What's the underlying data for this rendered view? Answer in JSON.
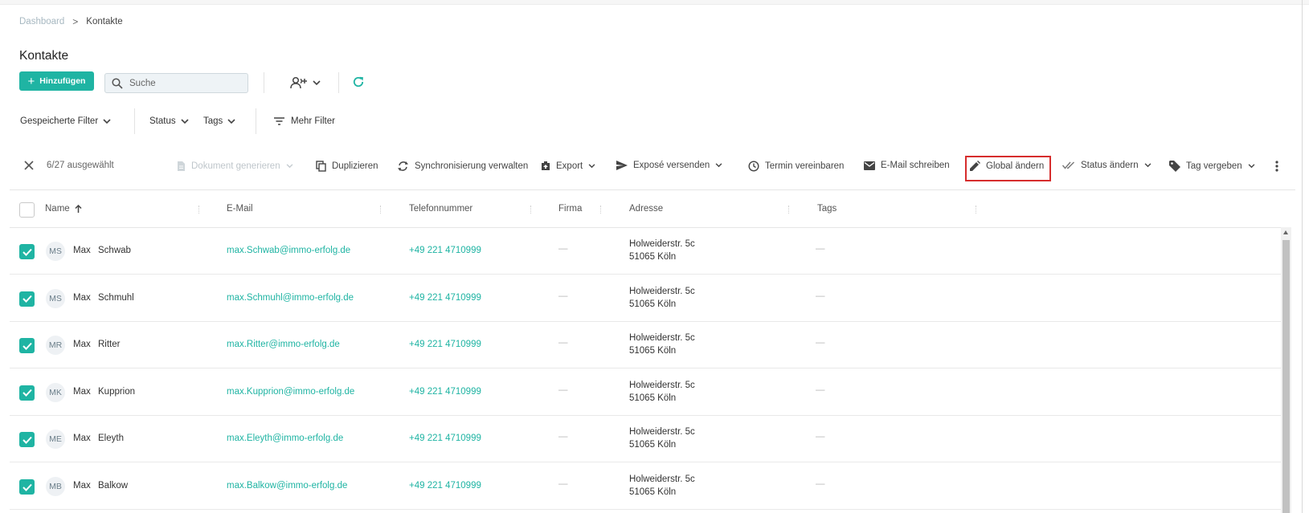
{
  "breadcrumb": {
    "items": [
      "Dashboard",
      "Kontakte"
    ],
    "separator": ">"
  },
  "page": {
    "title": "Kontakte"
  },
  "toolbar": {
    "add_label": "Hinzufügen",
    "search_placeholder": "Suche",
    "add_person_icon": "person-add-icon",
    "refresh_icon": "refresh-icon"
  },
  "filters": {
    "saved_filter": "Gespeicherte Filter",
    "status": "Status",
    "tags": "Tags",
    "more_filter": "Mehr Filter"
  },
  "actions": {
    "selected": "6/27 ausgewählt",
    "generate_document": "Dokument generieren",
    "duplicate": "Duplizieren",
    "sync": "Synchronisierung verwalten",
    "export": "Export",
    "send_expose": "Exposé versenden",
    "appointment": "Termin vereinbaren",
    "email": "E-Mail schreiben",
    "global_change": "Global ändern",
    "status_change": "Status ändern",
    "assign_tag": "Tag vergeben"
  },
  "table": {
    "columns": [
      "Name",
      "E-Mail",
      "Telefonnummer",
      "Firma",
      "Adresse",
      "Tags"
    ],
    "rows": [
      {
        "initials": "MS",
        "first": "Max",
        "last": "Schwab",
        "email": "max.Schwab@immo-erfolg.de",
        "phone": "+49 221 4710999",
        "firma": "—",
        "addr1": "Holweiderstr. 5c",
        "addr2": "51065 Köln",
        "tags": "—"
      },
      {
        "initials": "MS",
        "first": "Max",
        "last": "Schmuhl",
        "email": "max.Schmuhl@immo-erfolg.de",
        "phone": "+49 221 4710999",
        "firma": "—",
        "addr1": "Holweiderstr. 5c",
        "addr2": "51065 Köln",
        "tags": "—"
      },
      {
        "initials": "MR",
        "first": "Max",
        "last": "Ritter",
        "email": "max.Ritter@immo-erfolg.de",
        "phone": "+49 221 4710999",
        "firma": "—",
        "addr1": "Holweiderstr. 5c",
        "addr2": "51065 Köln",
        "tags": "—"
      },
      {
        "initials": "MK",
        "first": "Max",
        "last": "Kupprion",
        "email": "max.Kupprion@immo-erfolg.de",
        "phone": "+49 221 4710999",
        "firma": "—",
        "addr1": "Holweiderstr. 5c",
        "addr2": "51065 Köln",
        "tags": "—"
      },
      {
        "initials": "ME",
        "first": "Max",
        "last": "Eleyth",
        "email": "max.Eleyth@immo-erfolg.de",
        "phone": "+49 221 4710999",
        "firma": "—",
        "addr1": "Holweiderstr. 5c",
        "addr2": "51065 Köln",
        "tags": "—"
      },
      {
        "initials": "MB",
        "first": "Max",
        "last": "Balkow",
        "email": "max.Balkow@immo-erfolg.de",
        "phone": "+49 221 4710999",
        "firma": "—",
        "addr1": "Holweiderstr. 5c",
        "addr2": "51065 Köln",
        "tags": "—"
      }
    ]
  },
  "colors": {
    "accent": "#1fb4a3",
    "highlight": "#d62d2d"
  }
}
